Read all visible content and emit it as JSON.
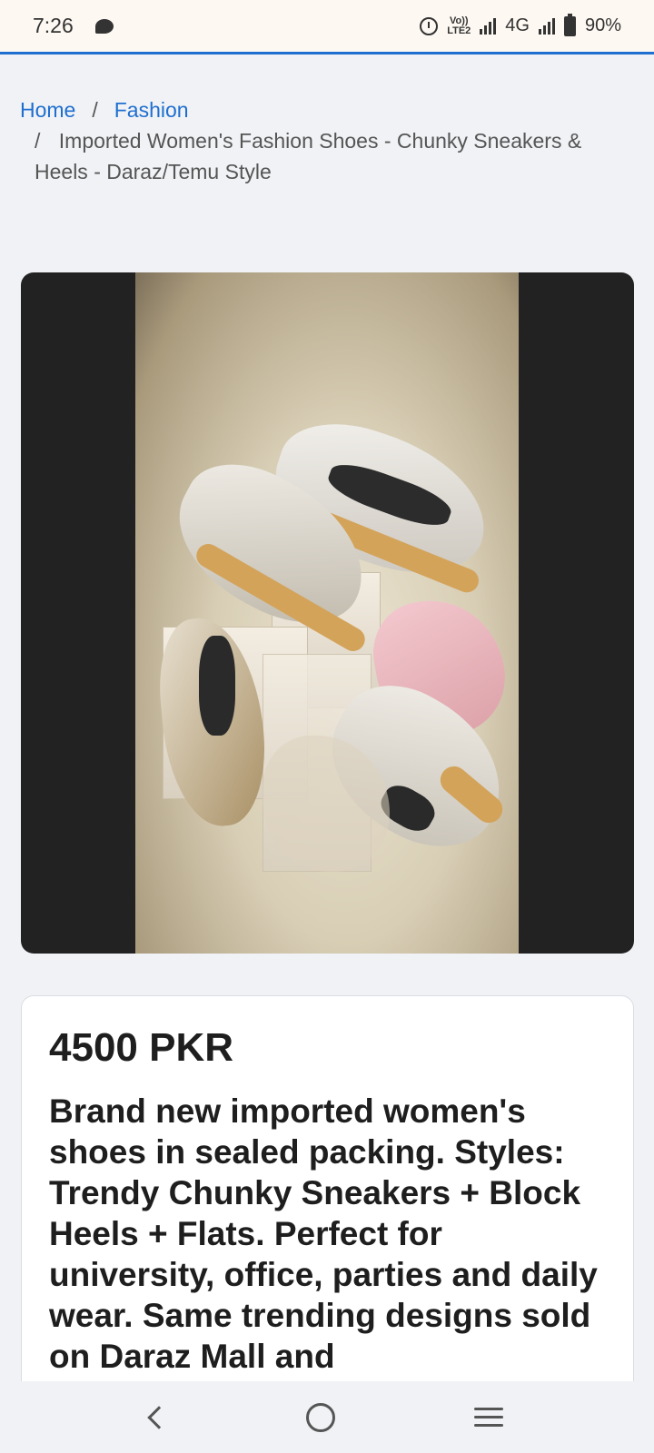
{
  "status_bar": {
    "time": "7:26",
    "volte_line1": "Vo))",
    "volte_line2": "LTE2",
    "network": "4G",
    "battery": "90%"
  },
  "breadcrumb": {
    "home": "Home",
    "separator": "/",
    "category": "Fashion",
    "current": "Imported Women's Fashion Shoes - Chunky Sneakers & Heels - Daraz/Temu Style"
  },
  "product": {
    "image_icon": "product-photo-sneakers",
    "price": "4500 PKR",
    "description": "Brand new imported women's shoes in sealed packing. Styles: Trendy Chunky Sneakers + Block Heels + Flats. Perfect for university, office, parties and daily wear. Same trending designs sold on Daraz Mall and"
  },
  "colors": {
    "link": "#1f6fd0",
    "text": "#1e1e1e",
    "image_background": "#222222"
  },
  "nav_bar": {
    "back_icon": "back-icon",
    "home_icon": "home-icon",
    "recents_icon": "recents-icon"
  }
}
